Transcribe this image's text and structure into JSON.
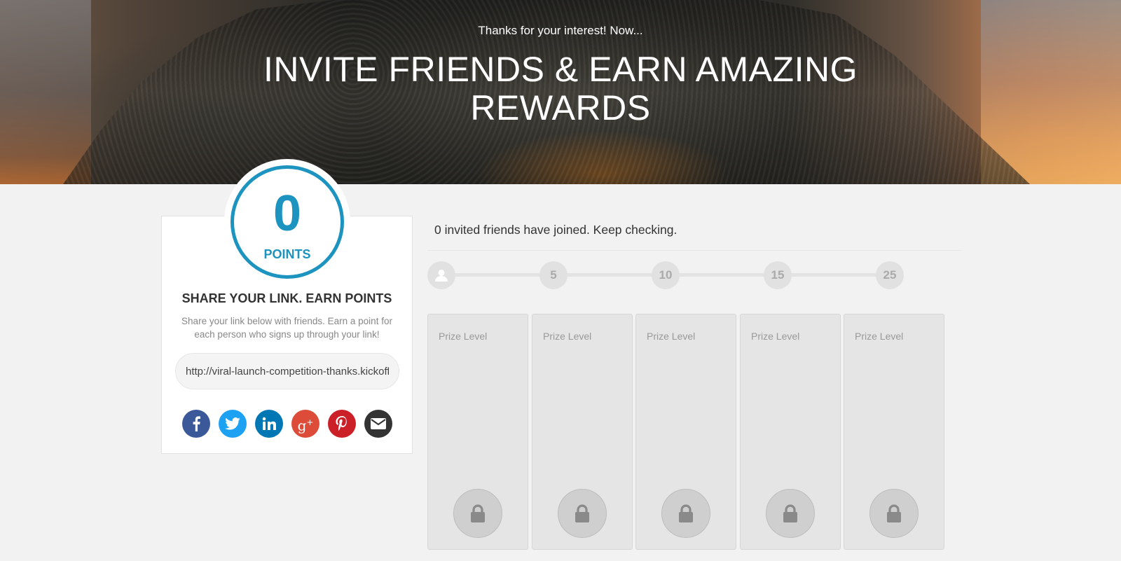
{
  "hero": {
    "subtitle": "Thanks for your interest! Now...",
    "title": "INVITE FRIENDS & EARN AMAZING REWARDS"
  },
  "points": {
    "value": "0",
    "label": "POINTS",
    "color": "#1d93bf"
  },
  "share": {
    "title": "SHARE YOUR LINK. EARN POINTS",
    "description": "Share your link below with friends. Earn a point for each person who signs up through your link!",
    "link": "http://viral-launch-competition-thanks.kickofflabs.com"
  },
  "social": [
    {
      "name": "facebook-icon",
      "color": "#3b5998"
    },
    {
      "name": "twitter-icon",
      "color": "#1da1f2"
    },
    {
      "name": "linkedin-icon",
      "color": "#0077b5"
    },
    {
      "name": "google-plus-icon",
      "color": "#dd4b39"
    },
    {
      "name": "pinterest-icon",
      "color": "#cb2027"
    },
    {
      "name": "email-icon",
      "color": "#333333"
    }
  ],
  "friends": {
    "status": "0 invited friends have joined. Keep checking."
  },
  "milestones": {
    "start_icon": "user-icon",
    "levels": [
      "5",
      "10",
      "15",
      "25"
    ]
  },
  "prizes": [
    {
      "label": "Prize Level",
      "locked": true
    },
    {
      "label": "Prize Level",
      "locked": true
    },
    {
      "label": "Prize Level",
      "locked": true
    },
    {
      "label": "Prize Level",
      "locked": true
    },
    {
      "label": "Prize Level",
      "locked": true
    }
  ]
}
